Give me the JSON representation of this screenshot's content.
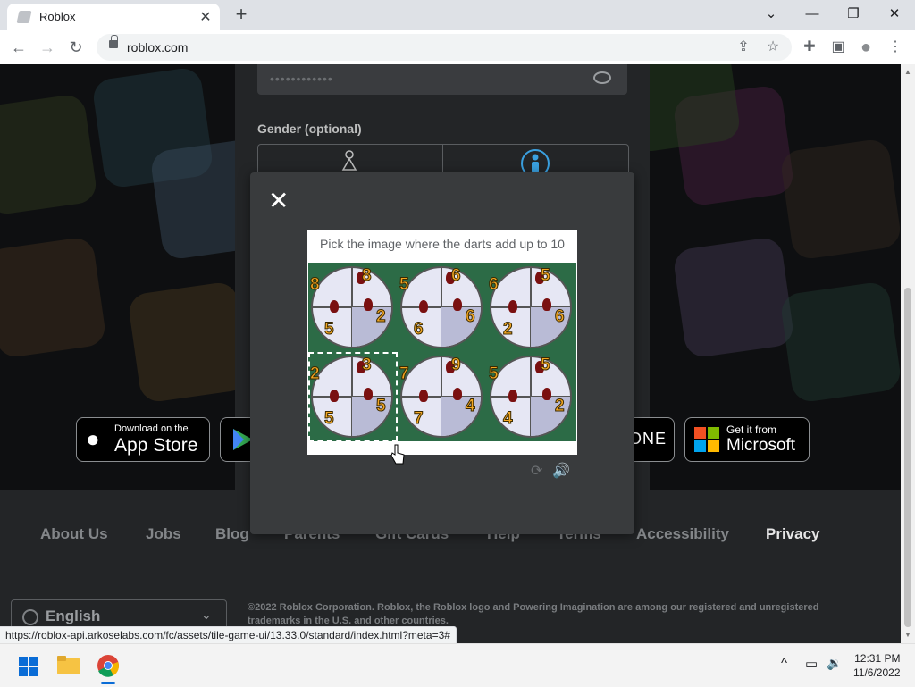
{
  "browser": {
    "tab_title": "Roblox",
    "tab_close": "✕",
    "new_tab": "+",
    "url": "roblox.com",
    "nav": {
      "back": "←",
      "forward": "→",
      "reload": "↻"
    },
    "window": {
      "chevron": "⌄",
      "minimize": "—",
      "restore": "❐",
      "close": "✕"
    },
    "toolbar_icons": {
      "share": "⇪",
      "star": "☆",
      "puzzle": "✚",
      "sidebar": "▣",
      "profile": "●",
      "menu": "⋮"
    }
  },
  "form": {
    "password_dots": "••••••••••••",
    "gender_label": "Gender (optional)"
  },
  "modal": {
    "close": "✕",
    "prompt": "Pick the image where the darts add up to 10",
    "reload_icon": "⟳",
    "audio_icon": "🔊",
    "tiles": [
      {
        "numbers": [
          "8",
          "8",
          "2",
          "5"
        ],
        "selected": false
      },
      {
        "numbers": [
          "5",
          "6",
          "6",
          "6"
        ],
        "selected": false
      },
      {
        "numbers": [
          "6",
          "5",
          "6",
          "2"
        ],
        "selected": false
      },
      {
        "numbers": [
          "2",
          "3",
          "5",
          "5"
        ],
        "selected": true
      },
      {
        "numbers": [
          "7",
          "9",
          "4",
          "7"
        ],
        "selected": false
      },
      {
        "numbers": [
          "5",
          "5",
          "2",
          "4"
        ],
        "selected": false
      }
    ]
  },
  "badges": {
    "appstore_small": "Download on the",
    "appstore_big": "App Store",
    "xbox": "ONE",
    "microsoft_small": "Get it from",
    "microsoft_big": "Microsoft"
  },
  "footer": {
    "links": [
      "About Us",
      "Jobs",
      "Blog",
      "Parents",
      "Gift Cards",
      "Help",
      "Terms",
      "Accessibility",
      "Privacy"
    ],
    "language": "English",
    "copyright": "©2022 Roblox Corporation. Roblox, the Roblox logo and Powering Imagination are among our registered and unregistered trademarks in the U.S. and other countries."
  },
  "status_url": "https://roblox-api.arkoselabs.com/fc/assets/tile-game-ui/13.33.0/standard/index.html?meta=3#",
  "taskbar": {
    "time": "12:31 PM",
    "date": "11/6/2022",
    "tray": {
      "chevron": "^",
      "network": "▭",
      "volume": "🔉"
    }
  },
  "colors": {
    "accent_gold": "#f2a623",
    "tile_green": "#2c6b46",
    "modal_bg": "#393b3d"
  }
}
